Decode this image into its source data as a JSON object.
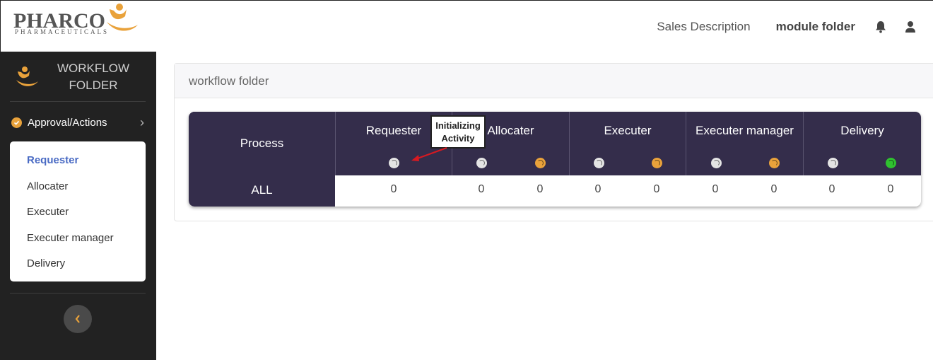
{
  "brand": {
    "logo_text": "PHARCO",
    "logo_sub": "PHARMACEUTICALS"
  },
  "header": {
    "links": [
      "Sales Description",
      "module folder"
    ],
    "icons": [
      "bell-icon",
      "user-icon"
    ]
  },
  "sidebar": {
    "title_line1": "WORKFLOW",
    "title_line2": "FOLDER",
    "section_label": "Approval/Actions",
    "items": [
      {
        "label": "Requester",
        "active": true
      },
      {
        "label": "Allocater",
        "active": false
      },
      {
        "label": "Executer",
        "active": false
      },
      {
        "label": "Executer manager",
        "active": false
      },
      {
        "label": "Delivery",
        "active": false
      }
    ]
  },
  "main": {
    "card_title": "workflow folder",
    "table": {
      "process_header": "Process",
      "row_label": "ALL",
      "stages": [
        {
          "name": "Requester",
          "statuses": [
            "gray"
          ],
          "values": [
            "0"
          ]
        },
        {
          "name": "Allocater",
          "statuses": [
            "gray",
            "orange"
          ],
          "values": [
            "0",
            "0"
          ]
        },
        {
          "name": "Executer",
          "statuses": [
            "gray",
            "orange"
          ],
          "values": [
            "0",
            "0"
          ]
        },
        {
          "name": "Executer manager",
          "statuses": [
            "gray",
            "orange"
          ],
          "values": [
            "0",
            "0"
          ]
        },
        {
          "name": "Delivery",
          "statuses": [
            "gray",
            "green"
          ],
          "values": [
            "0",
            "0"
          ]
        }
      ]
    }
  },
  "annotation": {
    "line1": "Initializing",
    "line2": "Activity"
  },
  "colors": {
    "accent": "#e9a23b",
    "header_bg": "#342d4b",
    "sidebar_bg": "#222222",
    "active_link": "#4a6bc4",
    "arrow": "#d71921"
  }
}
